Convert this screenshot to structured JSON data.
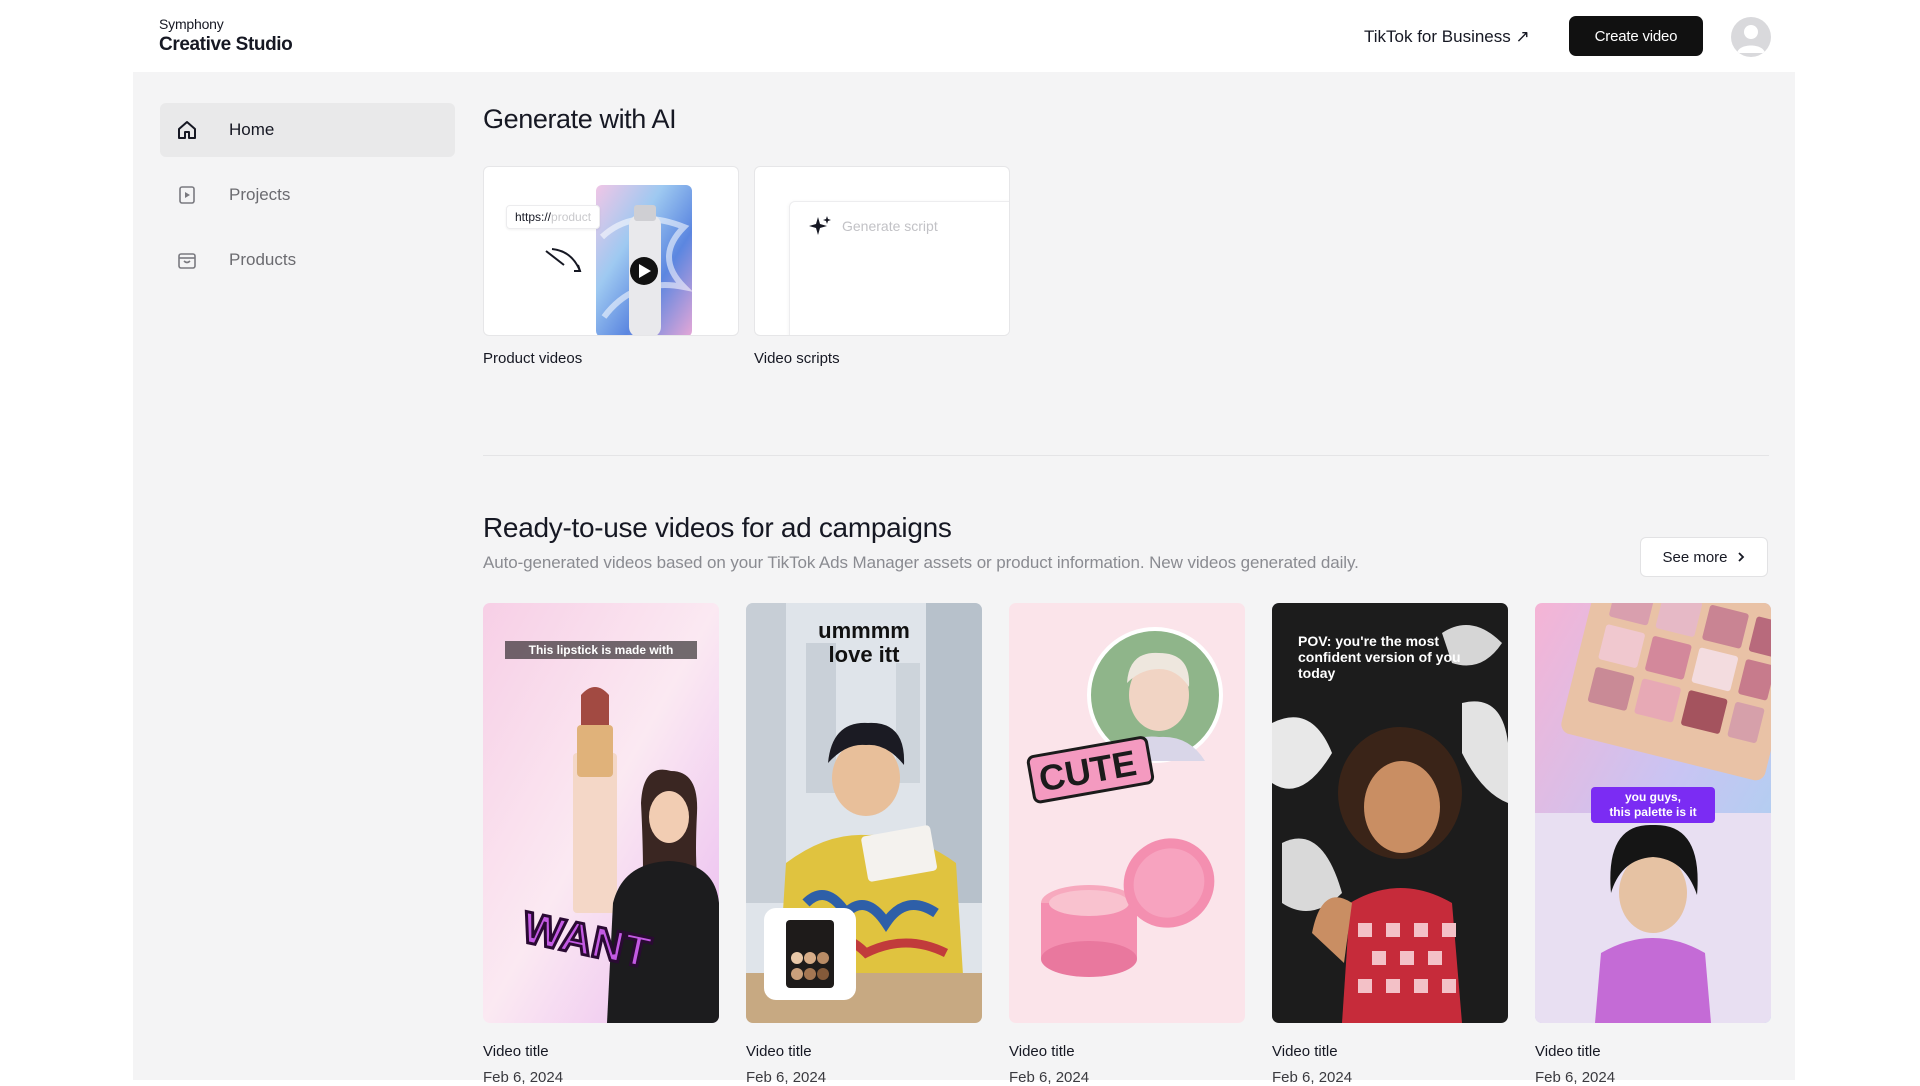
{
  "header": {
    "brand_small": "Symphony",
    "brand_big": "Creative Studio",
    "biz_link": "TikTok for Business ↗",
    "create_button": "Create video"
  },
  "sidebar": {
    "items": [
      {
        "label": "Home",
        "icon": "home-icon",
        "active": true
      },
      {
        "label": "Projects",
        "icon": "projects-icon",
        "active": false
      },
      {
        "label": "Products",
        "icon": "products-icon",
        "active": false
      }
    ]
  },
  "generate": {
    "title": "Generate with AI",
    "cards": [
      {
        "label": "Product videos",
        "url_tag": "https://",
        "url_tag_faded": "product"
      },
      {
        "label": "Video scripts",
        "placeholder": "Generate script"
      }
    ]
  },
  "ready": {
    "title": "Ready-to-use videos for ad campaigns",
    "subtitle": "Auto-generated videos based on your TikTok Ads Manager assets or product information. New videos generated daily.",
    "see_more": "See more",
    "videos": [
      {
        "title": "Video title",
        "date": "Feb 6, 2024",
        "overlay": "This lipstick is made with",
        "sticker": "WANT"
      },
      {
        "title": "Video title",
        "date": "Feb 6, 2024",
        "overlay": "ummmm\nlove itt"
      },
      {
        "title": "Video title",
        "date": "Feb 6, 2024",
        "sticker": "CUTE"
      },
      {
        "title": "Video title",
        "date": "Feb 6, 2024",
        "overlay": "POV: you're the most confident version of you today"
      },
      {
        "title": "Video title",
        "date": "Feb 6, 2024",
        "overlay": "you guys,\nthis palette is it"
      }
    ]
  },
  "colors": {
    "accent": "#111111",
    "shell_bg": "#f4f4f5",
    "active_bg": "#e9e9ea"
  }
}
